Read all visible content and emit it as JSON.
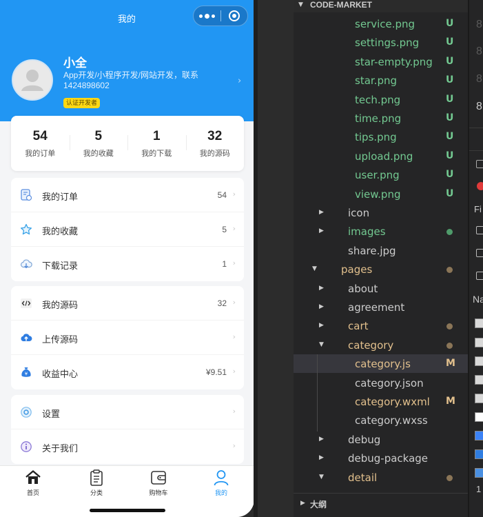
{
  "phone": {
    "nav_title": "我的",
    "profile": {
      "nickname": "小全",
      "bio": "App开发/小程序开发/网站开发，联系1424898602",
      "badge": "认证开发者"
    },
    "stats": [
      {
        "value": "54",
        "label": "我的订单"
      },
      {
        "value": "5",
        "label": "我的收藏"
      },
      {
        "value": "1",
        "label": "我的下载"
      },
      {
        "value": "32",
        "label": "我的源码"
      }
    ],
    "groups": [
      [
        {
          "icon": "order-icon",
          "label": "我的订单",
          "value": "54"
        },
        {
          "icon": "star-icon",
          "label": "我的收藏",
          "value": "5"
        },
        {
          "icon": "download-icon",
          "label": "下载记录",
          "value": "1"
        }
      ],
      [
        {
          "icon": "code-icon",
          "label": "我的源码",
          "value": "32"
        },
        {
          "icon": "upload-icon",
          "label": "上传源码",
          "value": ""
        },
        {
          "icon": "money-bag-icon",
          "label": "收益中心",
          "value": "¥9.51"
        }
      ],
      [
        {
          "icon": "settings-icon",
          "label": "设置",
          "value": ""
        },
        {
          "icon": "info-icon",
          "label": "关于我们",
          "value": ""
        }
      ]
    ],
    "tabbar": [
      {
        "icon": "home-icon",
        "label": "首页",
        "active": false
      },
      {
        "icon": "clipboard-icon",
        "label": "分类",
        "active": false
      },
      {
        "icon": "wallet-icon",
        "label": "购物车",
        "active": false
      },
      {
        "icon": "user-icon",
        "label": "我的",
        "active": true
      }
    ]
  },
  "explorer": {
    "title": "CODE-MARKET",
    "items": [
      {
        "name": "service.png",
        "depth": 3,
        "type": "file",
        "status": "U",
        "color": "#73c991"
      },
      {
        "name": "settings.png",
        "depth": 3,
        "type": "file",
        "status": "U",
        "color": "#73c991"
      },
      {
        "name": "star-empty.png",
        "depth": 3,
        "type": "file",
        "status": "U",
        "color": "#73c991"
      },
      {
        "name": "star.png",
        "depth": 3,
        "type": "file",
        "status": "U",
        "color": "#73c991"
      },
      {
        "name": "tech.png",
        "depth": 3,
        "type": "file",
        "status": "U",
        "color": "#73c991"
      },
      {
        "name": "time.png",
        "depth": 3,
        "type": "file",
        "status": "U",
        "color": "#73c991"
      },
      {
        "name": "tips.png",
        "depth": 3,
        "type": "file",
        "status": "U",
        "color": "#73c991"
      },
      {
        "name": "upload.png",
        "depth": 3,
        "type": "file",
        "status": "U",
        "color": "#73c991"
      },
      {
        "name": "user.png",
        "depth": 3,
        "type": "file",
        "status": "U",
        "color": "#73c991"
      },
      {
        "name": "view.png",
        "depth": 3,
        "type": "file",
        "status": "U",
        "color": "#73c991"
      },
      {
        "name": "icon",
        "depth": 2,
        "type": "folder",
        "expanded": false,
        "status": "",
        "color": "#cccccc"
      },
      {
        "name": "images",
        "depth": 2,
        "type": "folder",
        "expanded": false,
        "status": "dot",
        "color": "#73c991",
        "dot_color": "#4f9b6a"
      },
      {
        "name": "share.jpg",
        "depth": 2,
        "type": "file",
        "status": "",
        "color": "#cccccc"
      },
      {
        "name": "pages",
        "depth": 1,
        "type": "folder",
        "expanded": true,
        "status": "dot",
        "color": "#e2c08d",
        "dot_color": "#8a7557"
      },
      {
        "name": "about",
        "depth": 2,
        "type": "folder",
        "expanded": false,
        "status": "",
        "color": "#cccccc"
      },
      {
        "name": "agreement",
        "depth": 2,
        "type": "folder",
        "expanded": false,
        "status": "",
        "color": "#cccccc"
      },
      {
        "name": "cart",
        "depth": 2,
        "type": "folder",
        "expanded": false,
        "status": "dot",
        "color": "#e2c08d",
        "dot_color": "#8a7557"
      },
      {
        "name": "category",
        "depth": 2,
        "type": "folder",
        "expanded": true,
        "status": "dot",
        "color": "#e2c08d",
        "dot_color": "#8a7557"
      },
      {
        "name": "category.js",
        "depth": 3,
        "type": "file",
        "status": "M",
        "color": "#e2c08d",
        "selected": true
      },
      {
        "name": "category.json",
        "depth": 3,
        "type": "file",
        "status": "",
        "color": "#cccccc"
      },
      {
        "name": "category.wxml",
        "depth": 3,
        "type": "file",
        "status": "M",
        "color": "#e2c08d"
      },
      {
        "name": "category.wxss",
        "depth": 3,
        "type": "file",
        "status": "",
        "color": "#cccccc"
      },
      {
        "name": "debug",
        "depth": 2,
        "type": "folder",
        "expanded": false,
        "status": "",
        "color": "#cccccc"
      },
      {
        "name": "debug-package",
        "depth": 2,
        "type": "folder",
        "expanded": false,
        "status": "",
        "color": "#cccccc"
      },
      {
        "name": "detail",
        "depth": 2,
        "type": "folder",
        "expanded": true,
        "status": "dot",
        "color": "#e2c08d",
        "dot_color": "#8a7557"
      }
    ],
    "outline_title": "大纲"
  },
  "right_panel": {
    "fragments": [
      "8",
      "8",
      "8",
      "8",
      "Fi",
      "Na",
      "1"
    ]
  },
  "colors": {
    "primary": "#2196f3",
    "badge": "#ffd814",
    "untracked": "#73c991",
    "modified": "#e2c08d"
  }
}
